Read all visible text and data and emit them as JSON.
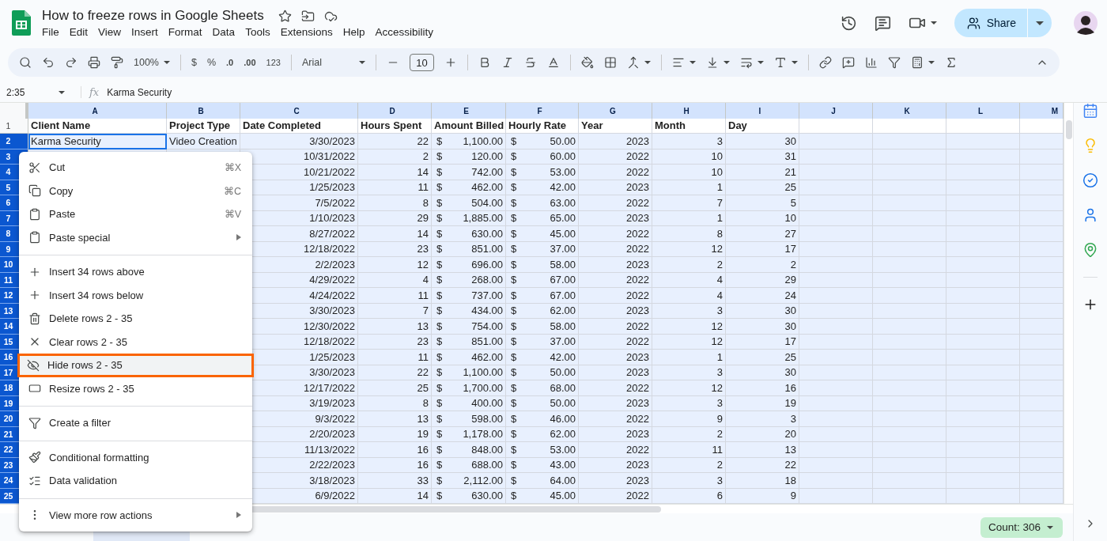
{
  "document": {
    "title": "How to freeze rows in Google Sheets",
    "menus": [
      "File",
      "Edit",
      "View",
      "Insert",
      "Format",
      "Data",
      "Tools",
      "Extensions",
      "Help",
      "Accessibility"
    ]
  },
  "share": {
    "label": "Share"
  },
  "toolbar": {
    "zoom": "100%",
    "currency": "$",
    "percent": "%",
    "decrease_decimals": ".0",
    "increase_decimals": ".00",
    "number_format": "123",
    "font": "Arial",
    "font_size": "10"
  },
  "formula_bar": {
    "cell_ref": "2:35",
    "fx": "fx",
    "content": "Karma Security"
  },
  "columns": [
    "A",
    "B",
    "C",
    "D",
    "E",
    "F",
    "G",
    "H",
    "I",
    "J",
    "K",
    "L",
    "M"
  ],
  "header_row": {
    "number": "1",
    "selected": false,
    "labels": [
      "Client Name",
      "Project Type",
      "Date Completed",
      "Hours Spent",
      "Amount Billed",
      "Hourly Rate",
      "Year",
      "Month",
      "Day"
    ]
  },
  "rows": [
    {
      "number": "2",
      "selected": true,
      "active": true,
      "client": "Karma Security",
      "project": "Video Creation",
      "date": "3/30/2023",
      "hours": "22",
      "billed_symbol": "$",
      "billed": "1,100.00",
      "rate_symbol": "$",
      "rate": "50.00",
      "year": "2023",
      "month": "3",
      "day": "30"
    },
    {
      "number": "3",
      "selected": true,
      "active": false,
      "date": "10/31/2022",
      "hours": "2",
      "billed_symbol": "$",
      "billed": "120.00",
      "rate_symbol": "$",
      "rate": "60.00",
      "year": "2022",
      "month": "10",
      "day": "31"
    },
    {
      "number": "4",
      "selected": true,
      "active": false,
      "date": "10/21/2022",
      "hours": "14",
      "billed_symbol": "$",
      "billed": "742.00",
      "rate_symbol": "$",
      "rate": "53.00",
      "year": "2022",
      "month": "10",
      "day": "21"
    },
    {
      "number": "5",
      "selected": true,
      "active": false,
      "date": "1/25/2023",
      "hours": "11",
      "billed_symbol": "$",
      "billed": "462.00",
      "rate_symbol": "$",
      "rate": "42.00",
      "year": "2023",
      "month": "1",
      "day": "25"
    },
    {
      "number": "6",
      "selected": true,
      "active": false,
      "date": "7/5/2022",
      "hours": "8",
      "billed_symbol": "$",
      "billed": "504.00",
      "rate_symbol": "$",
      "rate": "63.00",
      "year": "2022",
      "month": "7",
      "day": "5"
    },
    {
      "number": "7",
      "selected": true,
      "active": false,
      "date": "1/10/2023",
      "hours": "29",
      "billed_symbol": "$",
      "billed": "1,885.00",
      "rate_symbol": "$",
      "rate": "65.00",
      "year": "2023",
      "month": "1",
      "day": "10"
    },
    {
      "number": "8",
      "selected": true,
      "active": false,
      "date": "8/27/2022",
      "hours": "14",
      "billed_symbol": "$",
      "billed": "630.00",
      "rate_symbol": "$",
      "rate": "45.00",
      "year": "2022",
      "month": "8",
      "day": "27"
    },
    {
      "number": "9",
      "selected": true,
      "active": false,
      "date": "12/18/2022",
      "hours": "23",
      "billed_symbol": "$",
      "billed": "851.00",
      "rate_symbol": "$",
      "rate": "37.00",
      "year": "2022",
      "month": "12",
      "day": "17"
    },
    {
      "number": "10",
      "selected": true,
      "active": false,
      "date": "2/2/2023",
      "hours": "12",
      "billed_symbol": "$",
      "billed": "696.00",
      "rate_symbol": "$",
      "rate": "58.00",
      "year": "2023",
      "month": "2",
      "day": "2"
    },
    {
      "number": "11",
      "selected": true,
      "active": false,
      "date": "4/29/2022",
      "hours": "4",
      "billed_symbol": "$",
      "billed": "268.00",
      "rate_symbol": "$",
      "rate": "67.00",
      "year": "2022",
      "month": "4",
      "day": "29"
    },
    {
      "number": "12",
      "selected": true,
      "active": false,
      "date": "4/24/2022",
      "hours": "11",
      "billed_symbol": "$",
      "billed": "737.00",
      "rate_symbol": "$",
      "rate": "67.00",
      "year": "2022",
      "month": "4",
      "day": "24"
    },
    {
      "number": "13",
      "selected": true,
      "active": false,
      "date": "3/30/2023",
      "hours": "7",
      "billed_symbol": "$",
      "billed": "434.00",
      "rate_symbol": "$",
      "rate": "62.00",
      "year": "2023",
      "month": "3",
      "day": "30"
    },
    {
      "number": "14",
      "selected": true,
      "active": false,
      "date": "12/30/2022",
      "hours": "13",
      "billed_symbol": "$",
      "billed": "754.00",
      "rate_symbol": "$",
      "rate": "58.00",
      "year": "2022",
      "month": "12",
      "day": "30"
    },
    {
      "number": "15",
      "selected": true,
      "active": false,
      "date": "12/18/2022",
      "hours": "23",
      "billed_symbol": "$",
      "billed": "851.00",
      "rate_symbol": "$",
      "rate": "37.00",
      "year": "2022",
      "month": "12",
      "day": "17"
    },
    {
      "number": "16",
      "selected": true,
      "active": false,
      "date": "1/25/2023",
      "hours": "11",
      "billed_symbol": "$",
      "billed": "462.00",
      "rate_symbol": "$",
      "rate": "42.00",
      "year": "2023",
      "month": "1",
      "day": "25"
    },
    {
      "number": "17",
      "selected": true,
      "active": false,
      "date": "3/30/2023",
      "hours": "22",
      "billed_symbol": "$",
      "billed": "1,100.00",
      "rate_symbol": "$",
      "rate": "50.00",
      "year": "2023",
      "month": "3",
      "day": "30"
    },
    {
      "number": "18",
      "selected": true,
      "active": false,
      "date": "12/17/2022",
      "hours": "25",
      "billed_symbol": "$",
      "billed": "1,700.00",
      "rate_symbol": "$",
      "rate": "68.00",
      "year": "2022",
      "month": "12",
      "day": "16"
    },
    {
      "number": "19",
      "selected": true,
      "active": false,
      "date": "3/19/2023",
      "hours": "8",
      "billed_symbol": "$",
      "billed": "400.00",
      "rate_symbol": "$",
      "rate": "50.00",
      "year": "2023",
      "month": "3",
      "day": "19"
    },
    {
      "number": "20",
      "selected": true,
      "active": false,
      "date": "9/3/2022",
      "hours": "13",
      "billed_symbol": "$",
      "billed": "598.00",
      "rate_symbol": "$",
      "rate": "46.00",
      "year": "2022",
      "month": "9",
      "day": "3"
    },
    {
      "number": "21",
      "selected": true,
      "active": false,
      "date": "2/20/2023",
      "hours": "19",
      "billed_symbol": "$",
      "billed": "1,178.00",
      "rate_symbol": "$",
      "rate": "62.00",
      "year": "2023",
      "month": "2",
      "day": "20"
    },
    {
      "number": "22",
      "selected": true,
      "active": false,
      "date": "11/13/2022",
      "hours": "16",
      "billed_symbol": "$",
      "billed": "848.00",
      "rate_symbol": "$",
      "rate": "53.00",
      "year": "2022",
      "month": "11",
      "day": "13"
    },
    {
      "number": "23",
      "selected": true,
      "active": false,
      "date": "2/22/2023",
      "hours": "16",
      "billed_symbol": "$",
      "billed": "688.00",
      "rate_symbol": "$",
      "rate": "43.00",
      "year": "2023",
      "month": "2",
      "day": "22"
    },
    {
      "number": "24",
      "selected": true,
      "active": false,
      "date": "3/18/2023",
      "hours": "33",
      "billed_symbol": "$",
      "billed": "2,112.00",
      "rate_symbol": "$",
      "rate": "64.00",
      "year": "2023",
      "month": "3",
      "day": "18"
    },
    {
      "number": "25",
      "selected": true,
      "active": false,
      "date": "6/9/2022",
      "hours": "14",
      "billed_symbol": "$",
      "billed": "630.00",
      "rate_symbol": "$",
      "rate": "45.00",
      "year": "2022",
      "month": "6",
      "day": "9"
    }
  ],
  "context_menu": {
    "groups": [
      [
        {
          "label": "Cut",
          "shortcut": "⌘X",
          "submenu": false,
          "selected": false
        },
        {
          "label": "Copy",
          "shortcut": "⌘C",
          "submenu": false,
          "selected": false
        },
        {
          "label": "Paste",
          "shortcut": "⌘V",
          "submenu": false,
          "selected": false
        },
        {
          "label": "Paste special",
          "submenu": true,
          "selected": false
        }
      ],
      [
        {
          "label": "Insert 34 rows above",
          "submenu": false,
          "selected": false
        },
        {
          "label": "Insert 34 rows below",
          "submenu": false,
          "selected": false
        },
        {
          "label": "Delete rows 2 - 35",
          "submenu": false,
          "selected": false
        },
        {
          "label": "Clear rows 2 - 35",
          "submenu": false,
          "selected": false
        },
        {
          "label": "Hide rows 2 - 35",
          "submenu": false,
          "selected": true
        },
        {
          "label": "Resize rows 2 - 35",
          "submenu": false,
          "selected": false
        }
      ],
      [
        {
          "label": "Create a filter",
          "submenu": false,
          "selected": false
        }
      ],
      [
        {
          "label": "Conditional formatting",
          "submenu": false,
          "selected": false
        },
        {
          "label": "Data validation",
          "submenu": false,
          "selected": false
        }
      ],
      [
        {
          "label": "View more row actions",
          "submenu": true,
          "selected": false
        }
      ]
    ]
  },
  "status": {
    "count": "Count: 306"
  }
}
